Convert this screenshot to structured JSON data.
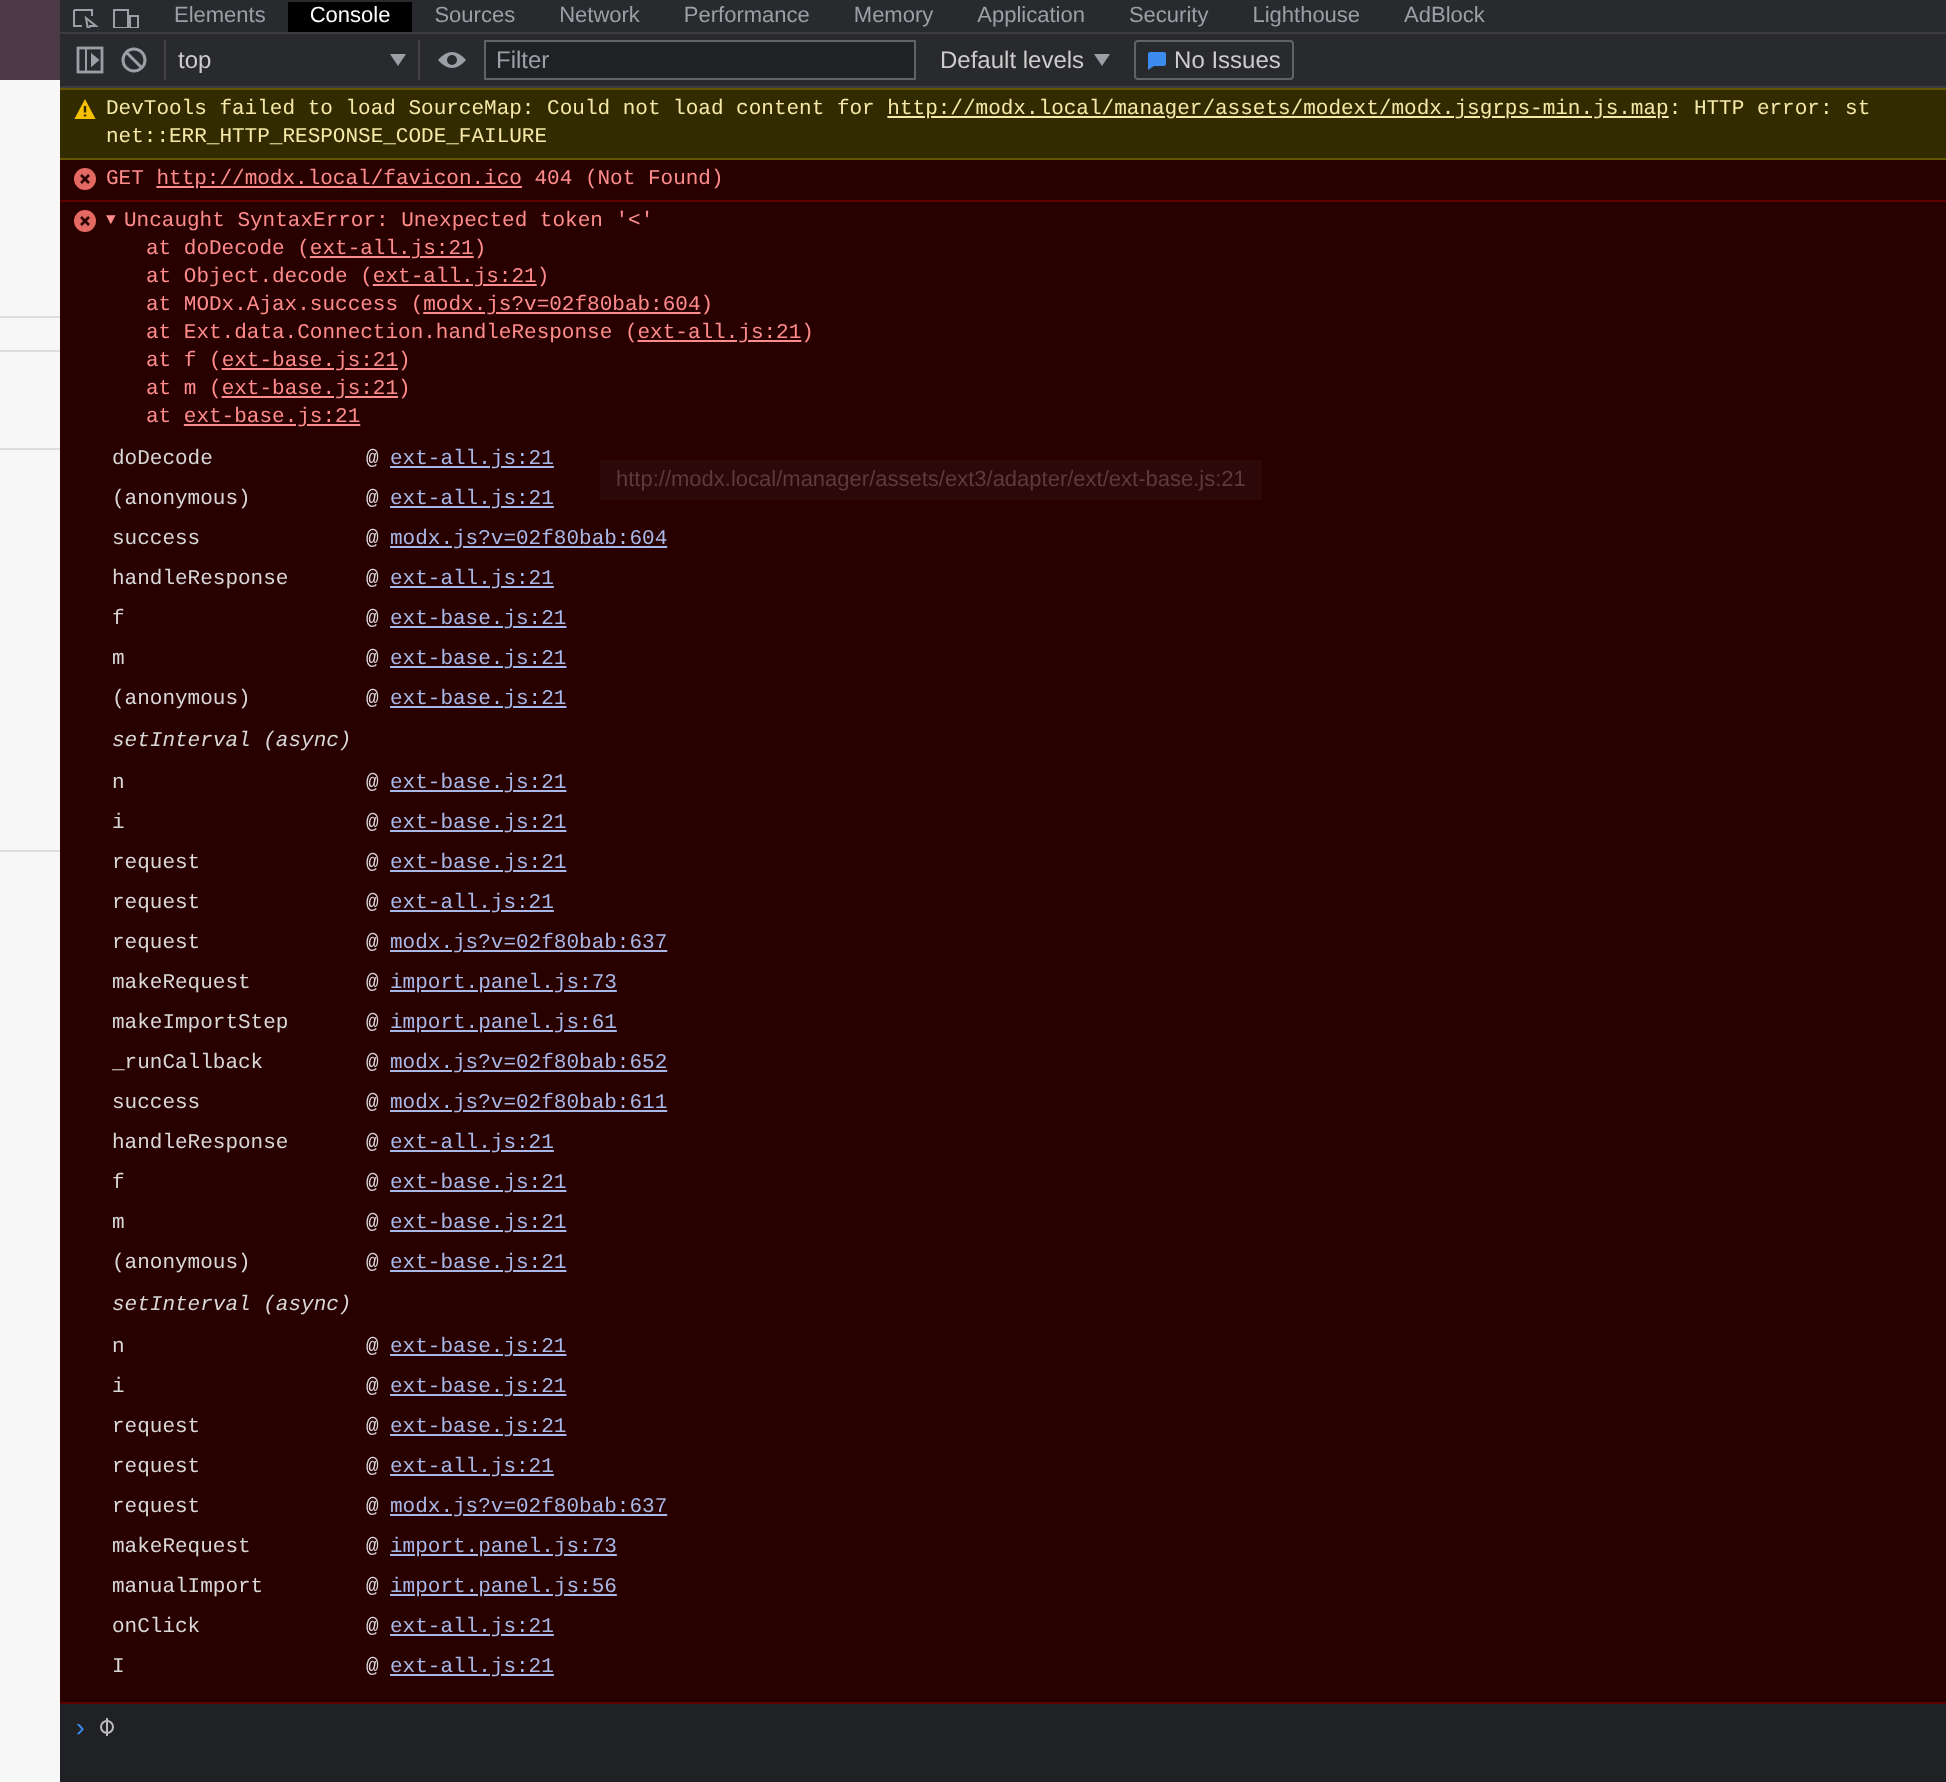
{
  "tabs": [
    {
      "label": "Elements",
      "selected": false
    },
    {
      "label": "Console",
      "selected": true
    },
    {
      "label": "Sources",
      "selected": false
    },
    {
      "label": "Network",
      "selected": false
    },
    {
      "label": "Performance",
      "selected": false
    },
    {
      "label": "Memory",
      "selected": false
    },
    {
      "label": "Application",
      "selected": false
    },
    {
      "label": "Security",
      "selected": false
    },
    {
      "label": "Lighthouse",
      "selected": false
    },
    {
      "label": "AdBlock",
      "selected": false
    }
  ],
  "toolbar": {
    "context": "top",
    "filter": {
      "placeholder": "Filter"
    },
    "levels": "Default levels",
    "issues": "No Issues"
  },
  "messages": [
    {
      "kind": "warning",
      "segments": [
        {
          "text": "DevTools failed to load SourceMap: Could not load content for ",
          "link": false
        },
        {
          "text": "http://modx.local/manager/assets/modext/modx.jsgrps-min.js.map",
          "link": true
        },
        {
          "text": ": HTTP error: st",
          "link": false
        }
      ],
      "second_line": "net::ERR_HTTP_RESPONSE_CODE_FAILURE"
    },
    {
      "kind": "error",
      "segments": [
        {
          "text": "GET ",
          "link": false
        },
        {
          "text": "http://modx.local/favicon.ico",
          "link": true
        },
        {
          "text": " 404 (Not Found)",
          "link": false
        }
      ]
    },
    {
      "kind": "exception",
      "expanded": true,
      "toggle": "▼",
      "heading": "Uncaught SyntaxError: Unexpected token '<'",
      "trace": [
        {
          "before": "at doDecode (",
          "link": "ext-all.js:21",
          "after": ")"
        },
        {
          "before": "at Object.decode (",
          "link": "ext-all.js:21",
          "after": ")"
        },
        {
          "before": "at MODx.Ajax.success (",
          "link": "modx.js?v=02f80bab:604",
          "after": ")"
        },
        {
          "before": "at Ext.data.Connection.handleResponse (",
          "link": "ext-all.js:21",
          "after": ")"
        },
        {
          "before": "at f (",
          "link": "ext-base.js:21",
          "after": ")"
        },
        {
          "before": "at m (",
          "link": "ext-base.js:21",
          "after": ")"
        },
        {
          "before": "at ",
          "link": "ext-base.js:21"
        }
      ],
      "frames": [
        {
          "kind": "frame",
          "function": "doDecode",
          "marker": "@",
          "link": "ext-all.js:21"
        },
        {
          "kind": "frame",
          "function": "(anonymous)",
          "marker": "@",
          "link": "ext-all.js:21"
        },
        {
          "kind": "frame",
          "function": "success",
          "marker": "@",
          "link": "modx.js?v=02f80bab:604"
        },
        {
          "kind": "frame",
          "function": "handleResponse",
          "marker": "@",
          "link": "ext-all.js:21"
        },
        {
          "kind": "frame",
          "function": "f",
          "marker": "@",
          "link": "ext-base.js:21"
        },
        {
          "kind": "frame",
          "function": "m",
          "marker": "@",
          "link": "ext-base.js:21"
        },
        {
          "kind": "frame",
          "function": "(anonymous)",
          "marker": "@",
          "link": "ext-base.js:21"
        },
        {
          "kind": "async",
          "label": "setInterval (async)"
        },
        {
          "kind": "frame",
          "function": "n",
          "marker": "@",
          "link": "ext-base.js:21"
        },
        {
          "kind": "frame",
          "function": "i",
          "marker": "@",
          "link": "ext-base.js:21"
        },
        {
          "kind": "frame",
          "function": "request",
          "marker": "@",
          "link": "ext-base.js:21"
        },
        {
          "kind": "frame",
          "function": "request",
          "marker": "@",
          "link": "ext-all.js:21"
        },
        {
          "kind": "frame",
          "function": "request",
          "marker": "@",
          "link": "modx.js?v=02f80bab:637"
        },
        {
          "kind": "frame",
          "function": "makeRequest",
          "marker": "@",
          "link": "import.panel.js:73"
        },
        {
          "kind": "frame",
          "function": "makeImportStep",
          "marker": "@",
          "link": "import.panel.js:61"
        },
        {
          "kind": "frame",
          "function": "_runCallback",
          "marker": "@",
          "link": "modx.js?v=02f80bab:652"
        },
        {
          "kind": "frame",
          "function": "success",
          "marker": "@",
          "link": "modx.js?v=02f80bab:611"
        },
        {
          "kind": "frame",
          "function": "handleResponse",
          "marker": "@",
          "link": "ext-all.js:21"
        },
        {
          "kind": "frame",
          "function": "f",
          "marker": "@",
          "link": "ext-base.js:21"
        },
        {
          "kind": "frame",
          "function": "m",
          "marker": "@",
          "link": "ext-base.js:21"
        },
        {
          "kind": "frame",
          "function": "(anonymous)",
          "marker": "@",
          "link": "ext-base.js:21"
        },
        {
          "kind": "async",
          "label": "setInterval (async)"
        },
        {
          "kind": "frame",
          "function": "n",
          "marker": "@",
          "link": "ext-base.js:21"
        },
        {
          "kind": "frame",
          "function": "i",
          "marker": "@",
          "link": "ext-base.js:21"
        },
        {
          "kind": "frame",
          "function": "request",
          "marker": "@",
          "link": "ext-base.js:21"
        },
        {
          "kind": "frame",
          "function": "request",
          "marker": "@",
          "link": "ext-all.js:21"
        },
        {
          "kind": "frame",
          "function": "request",
          "marker": "@",
          "link": "modx.js?v=02f80bab:637"
        },
        {
          "kind": "frame",
          "function": "makeRequest",
          "marker": "@",
          "link": "import.panel.js:73"
        },
        {
          "kind": "frame",
          "function": "manualImport",
          "marker": "@",
          "link": "import.panel.js:56"
        },
        {
          "kind": "frame",
          "function": "onClick",
          "marker": "@",
          "link": "ext-all.js:21"
        },
        {
          "kind": "frame",
          "function": "I",
          "marker": "@",
          "link": "ext-all.js:21"
        }
      ],
      "tooltip": "http://modx.local/manager/assets/ext3/adapter/ext/ext-base.js:21"
    }
  ],
  "prompt": {
    "symbol": "›"
  }
}
